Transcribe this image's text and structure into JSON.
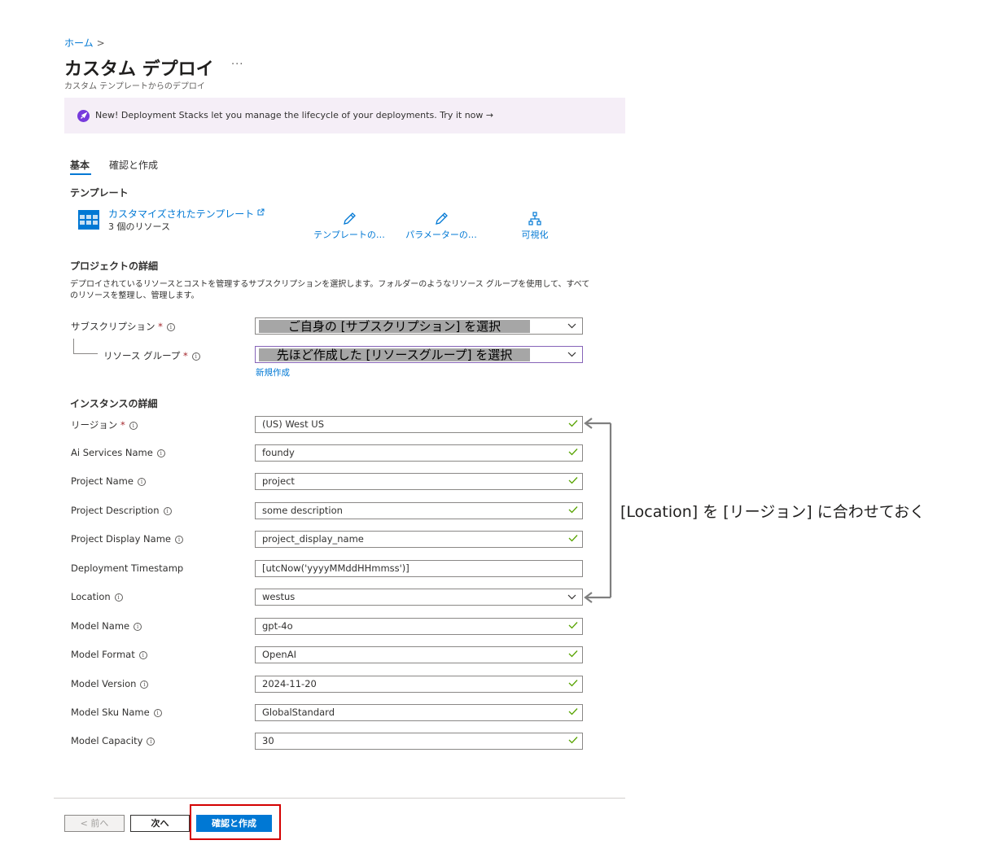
{
  "breadcrumb": {
    "home": "ホーム",
    "separator": ">"
  },
  "page": {
    "title": "カスタム デプロイ",
    "more": "···",
    "subtitle": "カスタム テンプレートからのデプロイ"
  },
  "banner": {
    "text": "New! Deployment Stacks let you manage the lifecycle of your deployments. Try it now →",
    "icon": "rocket-icon"
  },
  "tabs": [
    {
      "label": "基本"
    },
    {
      "label": "確認と作成"
    }
  ],
  "template": {
    "section_title": "テンプレート",
    "name": "カスタマイズされたテンプレート",
    "resource_count": "3 個のリソース",
    "actions": [
      {
        "label": "テンプレートの…",
        "icon": "pencil-icon"
      },
      {
        "label": "パラメーターの…",
        "icon": "pencil-icon"
      },
      {
        "label": "可視化",
        "icon": "hierarchy-icon"
      }
    ]
  },
  "project": {
    "section_title": "プロジェクトの詳細",
    "description": "デプロイされているリソースとコストを管理するサブスクリプションを選択します。フォルダーのようなリソース グループを使用して、すべてのリソースを整理し、管理します。",
    "subscription_label": "サブスクリプション",
    "subscription_value": "ご自身の [サブスクリプション] を選択",
    "resource_group_label": "リソース グループ",
    "resource_group_value": "先ほど作成した [リソースグループ] を選択",
    "new_link": "新規作成"
  },
  "instance": {
    "section_title": "インスタンスの詳細",
    "region_label": "リージョン",
    "region_value": "(US) West US",
    "fields": [
      {
        "label": "Ai Services Name",
        "value": "foundy"
      },
      {
        "label": "Project Name",
        "value": "project"
      },
      {
        "label": "Project Description",
        "value": "some description"
      },
      {
        "label": "Project Display Name",
        "value": "project_display_name"
      },
      {
        "label": "Deployment Timestamp",
        "value": "[utcNow('yyyyMMddHHmmss')]"
      },
      {
        "label": "Location",
        "value": "westus"
      },
      {
        "label": "Model Name",
        "value": "gpt-4o"
      },
      {
        "label": "Model Format",
        "value": "OpenAI"
      },
      {
        "label": "Model Version",
        "value": "2024-11-20"
      },
      {
        "label": "Model Sku Name",
        "value": "GlobalStandard"
      },
      {
        "label": "Model Capacity",
        "value": "30"
      }
    ]
  },
  "annotation": {
    "text": "[Location] を [リージョン] に合わせておく"
  },
  "footer": {
    "prev_label": "< 前へ",
    "next_label": "次へ",
    "create_label": "確認と作成"
  },
  "required_mark": "*",
  "info_glyph": "i",
  "colors": {
    "accent": "#0078d4",
    "highlight_box": "#d40000",
    "valid": "#57a300",
    "banner_bg": "#f5eef7"
  }
}
